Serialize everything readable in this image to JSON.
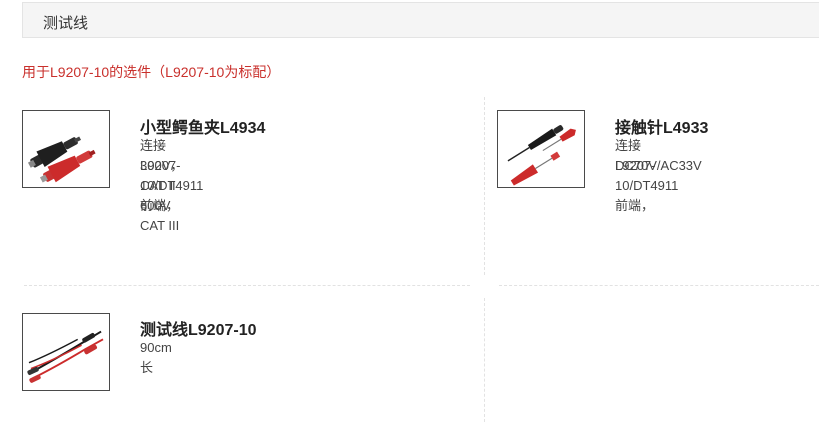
{
  "section": {
    "title": "测试线"
  },
  "subtitle": "用于L9207-10的选件（L9207-10为标配）",
  "products": [
    {
      "name": "小型鳄鱼夹L4934",
      "desc_line1": "连接L9207-10/DT4911前端，CAT III",
      "desc_line2": "300V，CAT II 600V",
      "image_icon": "alligator-clip-icon"
    },
    {
      "name": "接触针L4933",
      "desc_line1": "连接L9207-10/DT4911前端，",
      "desc_line2": "DC70V/AC33V",
      "image_icon": "contact-pin-icon"
    },
    {
      "name": "测试线L9207-10",
      "desc_line1": "90cm长",
      "desc_line2": "",
      "image_icon": "test-lead-icon"
    }
  ],
  "colors": {
    "accent_red": "#c9302c",
    "probe_red": "#cc2b2b",
    "probe_black": "#1a1a1a"
  }
}
